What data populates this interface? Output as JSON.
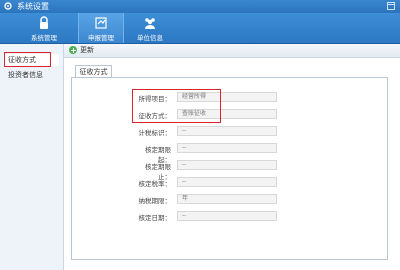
{
  "window": {
    "title": "系统设置"
  },
  "toolbar": {
    "items": [
      {
        "label": "系统管理",
        "icon": "lock-icon"
      },
      {
        "label": "申报管理",
        "icon": "form-icon"
      },
      {
        "label": "单位信息",
        "icon": "users-icon"
      }
    ],
    "active_index": 1
  },
  "sidebar": {
    "items": [
      {
        "label": "征收方式",
        "selected": true
      },
      {
        "label": "投资者信息",
        "selected": false
      }
    ]
  },
  "action_bar": {
    "update_label": "更新"
  },
  "tab": {
    "label": "征收方式"
  },
  "form": {
    "rows": [
      {
        "label": "所得项目：",
        "value": "经营所得"
      },
      {
        "label": "征收方式：",
        "value": "查账征收"
      },
      {
        "label": "计税标识：",
        "value": "--"
      },
      {
        "label": "核定期限起：",
        "value": "--"
      },
      {
        "label": "核定期限止：",
        "value": "--"
      },
      {
        "label": "核定税率：",
        "value": "--"
      },
      {
        "label": "纳税期限：",
        "value": "年"
      },
      {
        "label": "核定日期：",
        "value": "--"
      }
    ]
  },
  "colors": {
    "titlebar": "#2b74bd",
    "highlight_box": "#d9262c"
  }
}
